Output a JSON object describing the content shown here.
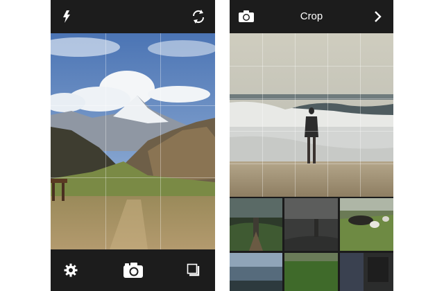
{
  "camera_screen": {
    "top_bar": {
      "flash_icon": "flash-icon",
      "switch_camera_icon": "switch-camera-icon"
    },
    "bottom_bar": {
      "settings_icon": "gear-icon",
      "shutter_icon": "camera-icon",
      "gallery_icon": "gallery-icon"
    }
  },
  "crop_screen": {
    "top_bar": {
      "title": "Crop",
      "camera_icon": "camera-icon",
      "next_icon": "chevron-right-icon"
    },
    "thumbnails": [
      "photo-thumbnail",
      "photo-thumbnail",
      "photo-thumbnail",
      "photo-thumbnail",
      "photo-thumbnail",
      "photo-thumbnail"
    ]
  }
}
